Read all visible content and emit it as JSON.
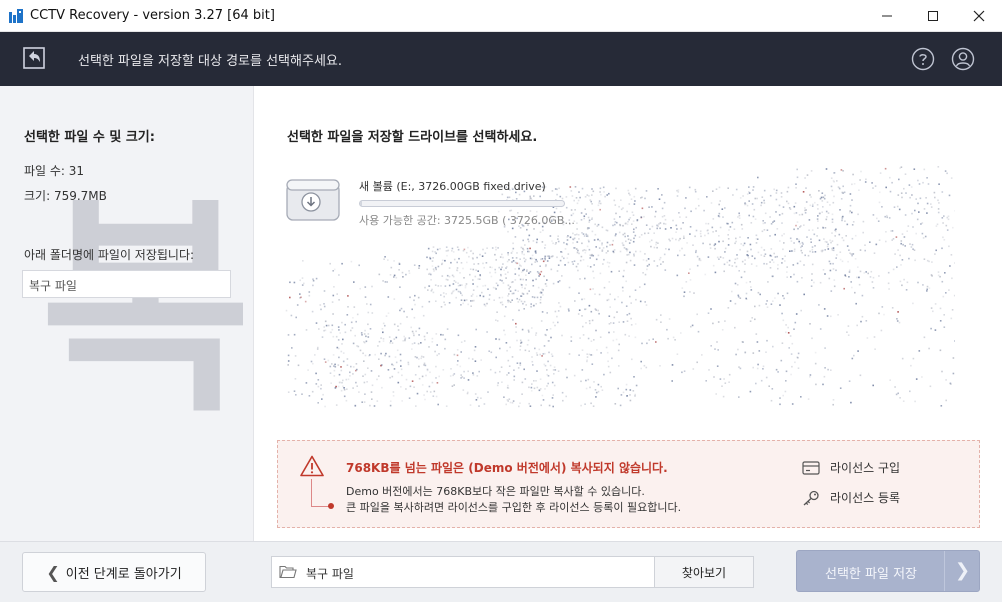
{
  "window": {
    "title": "CCTV Recovery - version 3.27 [64 bit]",
    "minimize_icon": "minimize-icon",
    "maximize_icon": "maximize-icon",
    "close_icon": "close-icon"
  },
  "header": {
    "text": "선택한 파일을 저장할 대상 경로를 선택해주세요.",
    "back_icon": "back-icon",
    "help_icon": "help-icon",
    "user_icon": "user-icon"
  },
  "left_panel": {
    "title": "선택한 파일 수 및 크기:",
    "file_count": "파일 수: 31",
    "size": "크기: 759.7MB",
    "folder_label": "아래 폴더명에 파일이 저장됩니다:",
    "folder_value": "복구 파일",
    "watermark": "복"
  },
  "main": {
    "title": "선택한 파일을 저장할 드라이브를 선택하세요.",
    "drive": {
      "name": "새 볼륨 (E:, 3726.00GB fixed drive)",
      "free": "사용 가능한 공간: 3725.5GB ( 3726.0GB...",
      "used_fraction": 0.0001
    }
  },
  "warning": {
    "title": "768KB를 넘는 파일은 (Demo 버전에서) 복사되지 않습니다.",
    "line1": "Demo 버전에서는 768KB보다 작은 파일만 복사할 수 있습니다.",
    "line2": "큰 파일을 복사하려면 라이선스를 구입한 후 라이선스 등록이 필요합니다.",
    "buy_license": "라이선스 구입",
    "register_license": "라이선스 등록"
  },
  "bottom": {
    "back_label": "이전 단계로 돌아가기",
    "path_value": "복구 파일",
    "browse_label": "찾아보기",
    "save_label": "선택한 파일 저장"
  },
  "colors": {
    "header_bg": "#262a37",
    "warning_text": "#c0392b",
    "save_button": "#a9b3cd"
  }
}
